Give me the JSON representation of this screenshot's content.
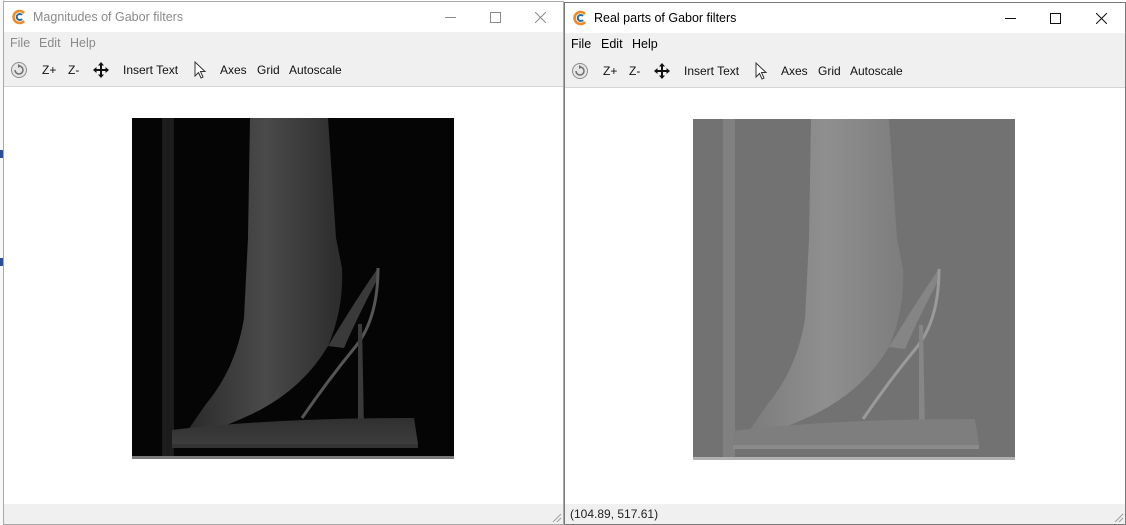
{
  "windows": [
    {
      "title": "Magnitudes of Gabor filters",
      "active": false,
      "menu": [
        "File",
        "Edit",
        "Help"
      ],
      "toolbar": {
        "zoom_in": "Z+",
        "zoom_out": "Z-",
        "insert_text": "Insert Text",
        "axes": "Axes",
        "grid": "Grid",
        "autoscale": "Autoscale"
      },
      "status": ""
    },
    {
      "title": "Real parts of Gabor filters",
      "active": true,
      "menu": [
        "File",
        "Edit",
        "Help"
      ],
      "toolbar": {
        "zoom_in": "Z+",
        "zoom_out": "Z-",
        "insert_text": "Insert Text",
        "axes": "Axes",
        "grid": "Grid",
        "autoscale": "Autoscale"
      },
      "status": "(104.89, 517.61)"
    }
  ],
  "colors": {
    "icon_orange": "#f08a24",
    "icon_blue": "#1f6fb5",
    "toolbar_bg": "#f0f0f0",
    "magnitude_bg": "#050505",
    "real_part_bg": "#727272"
  },
  "icons": [
    "app-logo-icon",
    "minimize-icon",
    "maximize-icon",
    "close-icon",
    "rotate-icon",
    "move-icon",
    "pointer-icon",
    "size-grip-icon"
  ]
}
